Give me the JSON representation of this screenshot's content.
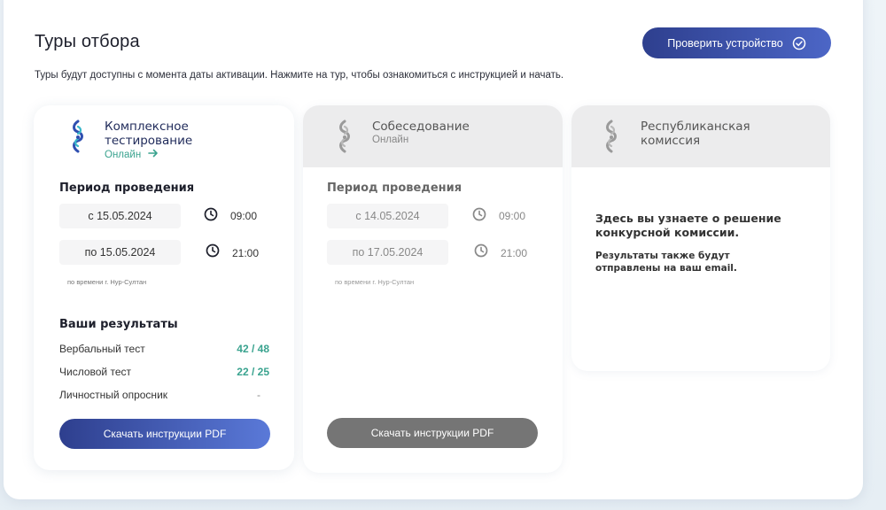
{
  "header": {
    "title": "Туры отбора",
    "verify_button": "Проверить устройство",
    "subtitle": "Туры будут доступны с момента даты активации. Нажмите на тур, чтобы ознакомиться с инструкцией и начать."
  },
  "colors": {
    "accent": "#3a4fa8",
    "success": "#3aa38f",
    "inactive": "#757575"
  },
  "tours": [
    {
      "title_line1": "Комплексное",
      "title_line2": "тестирование",
      "status": "Онлайн",
      "period_title": "Периoд проведения",
      "start_date": "с 15.05.2024",
      "start_time": "09:00",
      "end_date": "по 15.05.2024",
      "end_time": "21:00",
      "timezone_note": "по времени г. Нур-Султан",
      "results_title": "Ваши результаты",
      "results": [
        {
          "label": "Вербальный тест",
          "value": "42 / 48"
        },
        {
          "label": "Числовой тест",
          "value": "22 / 25"
        },
        {
          "label": "Личностный опросник",
          "value": "-"
        }
      ],
      "download_button": "Скачать инструкции PDF"
    },
    {
      "title_line1": "Собеседование",
      "status": "Онлайн",
      "period_title": "Период проведения",
      "start_date": "с 14.05.2024",
      "start_time": "09:00",
      "end_date": "по 17.05.2024",
      "end_time": "21:00",
      "timezone_note": "по времени г. Нур-Султан",
      "download_button": "Скачать инструкции PDF"
    },
    {
      "title_line1": "Республиканская",
      "title_line2": "комиссия",
      "info_line1": "Здесь вы узнаете о решение",
      "info_line2": "конкурсной комиссии.",
      "note_line1": "Результаты также будут",
      "note_line2": "отправлены на ваш email."
    }
  ]
}
